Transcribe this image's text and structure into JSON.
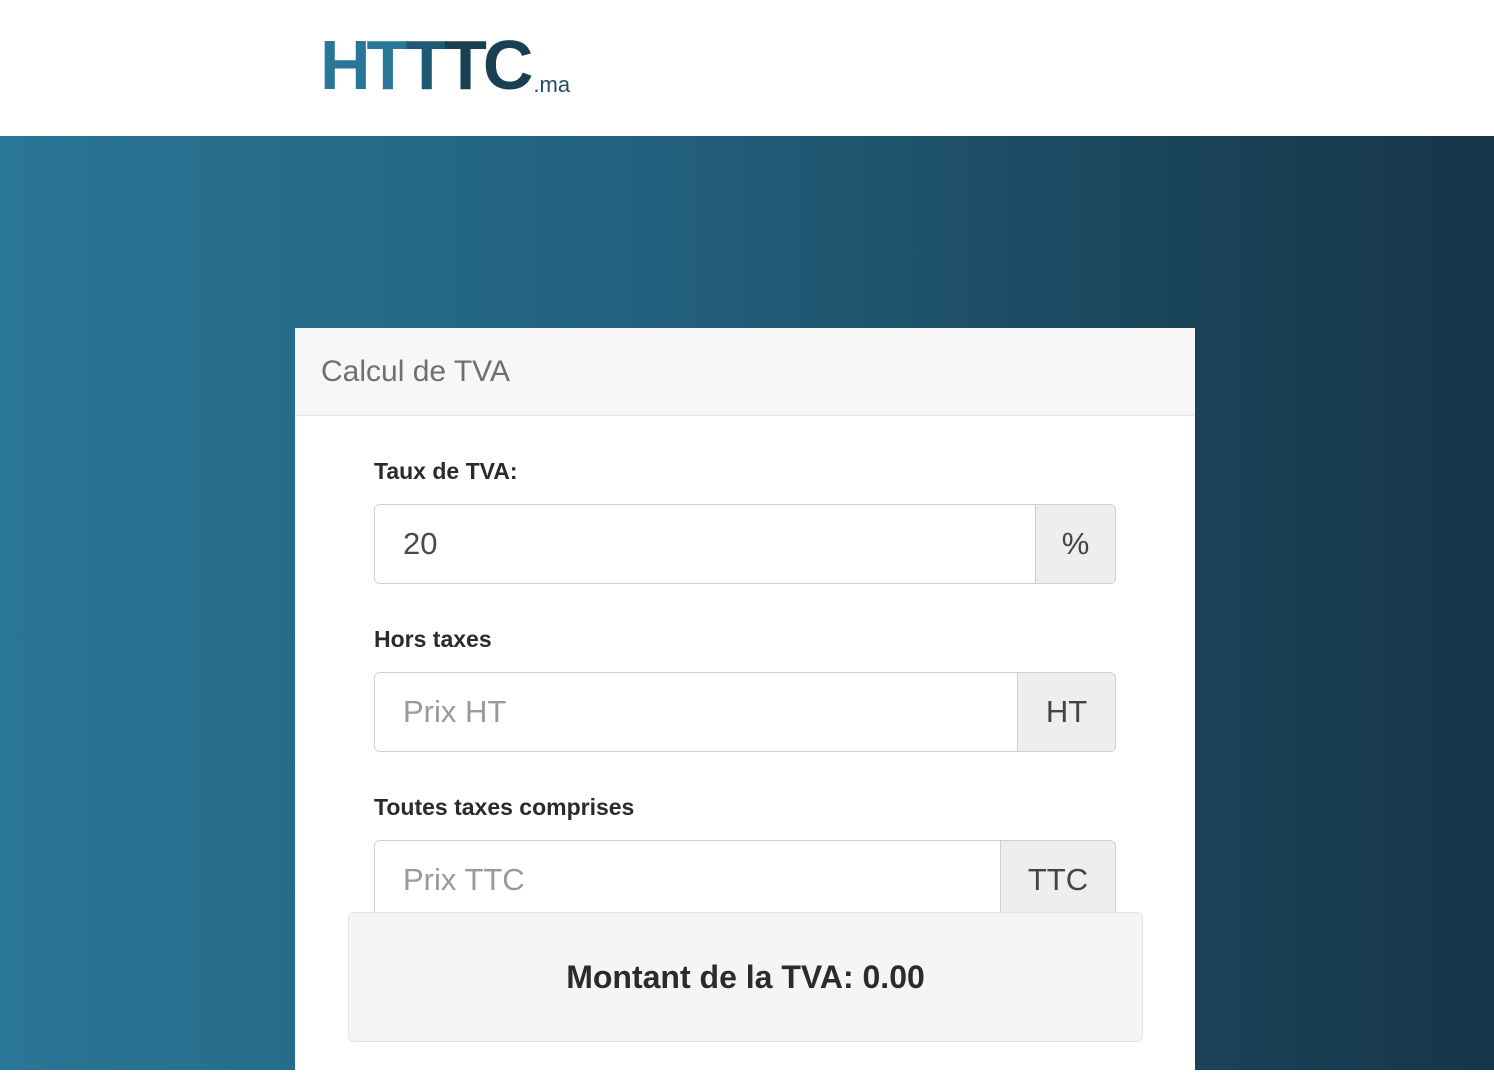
{
  "logo": {
    "part1": "HT",
    "part2": "T",
    "part3": "TC",
    "suffix": ".ma"
  },
  "card": {
    "title": "Calcul de TVA"
  },
  "fields": {
    "tva": {
      "label": "Taux de TVA:",
      "value": "20",
      "addon": "%"
    },
    "ht": {
      "label": "Hors taxes",
      "placeholder": "Prix HT",
      "value": "",
      "addon": "HT"
    },
    "ttc": {
      "label": "Toutes taxes comprises",
      "placeholder": "Prix TTC",
      "value": "",
      "addon": "TTC"
    }
  },
  "result": {
    "text": "Montant de la TVA: 0.00"
  },
  "colors": {
    "brand_light": "#2a7696",
    "brand_dark": "#163649"
  }
}
